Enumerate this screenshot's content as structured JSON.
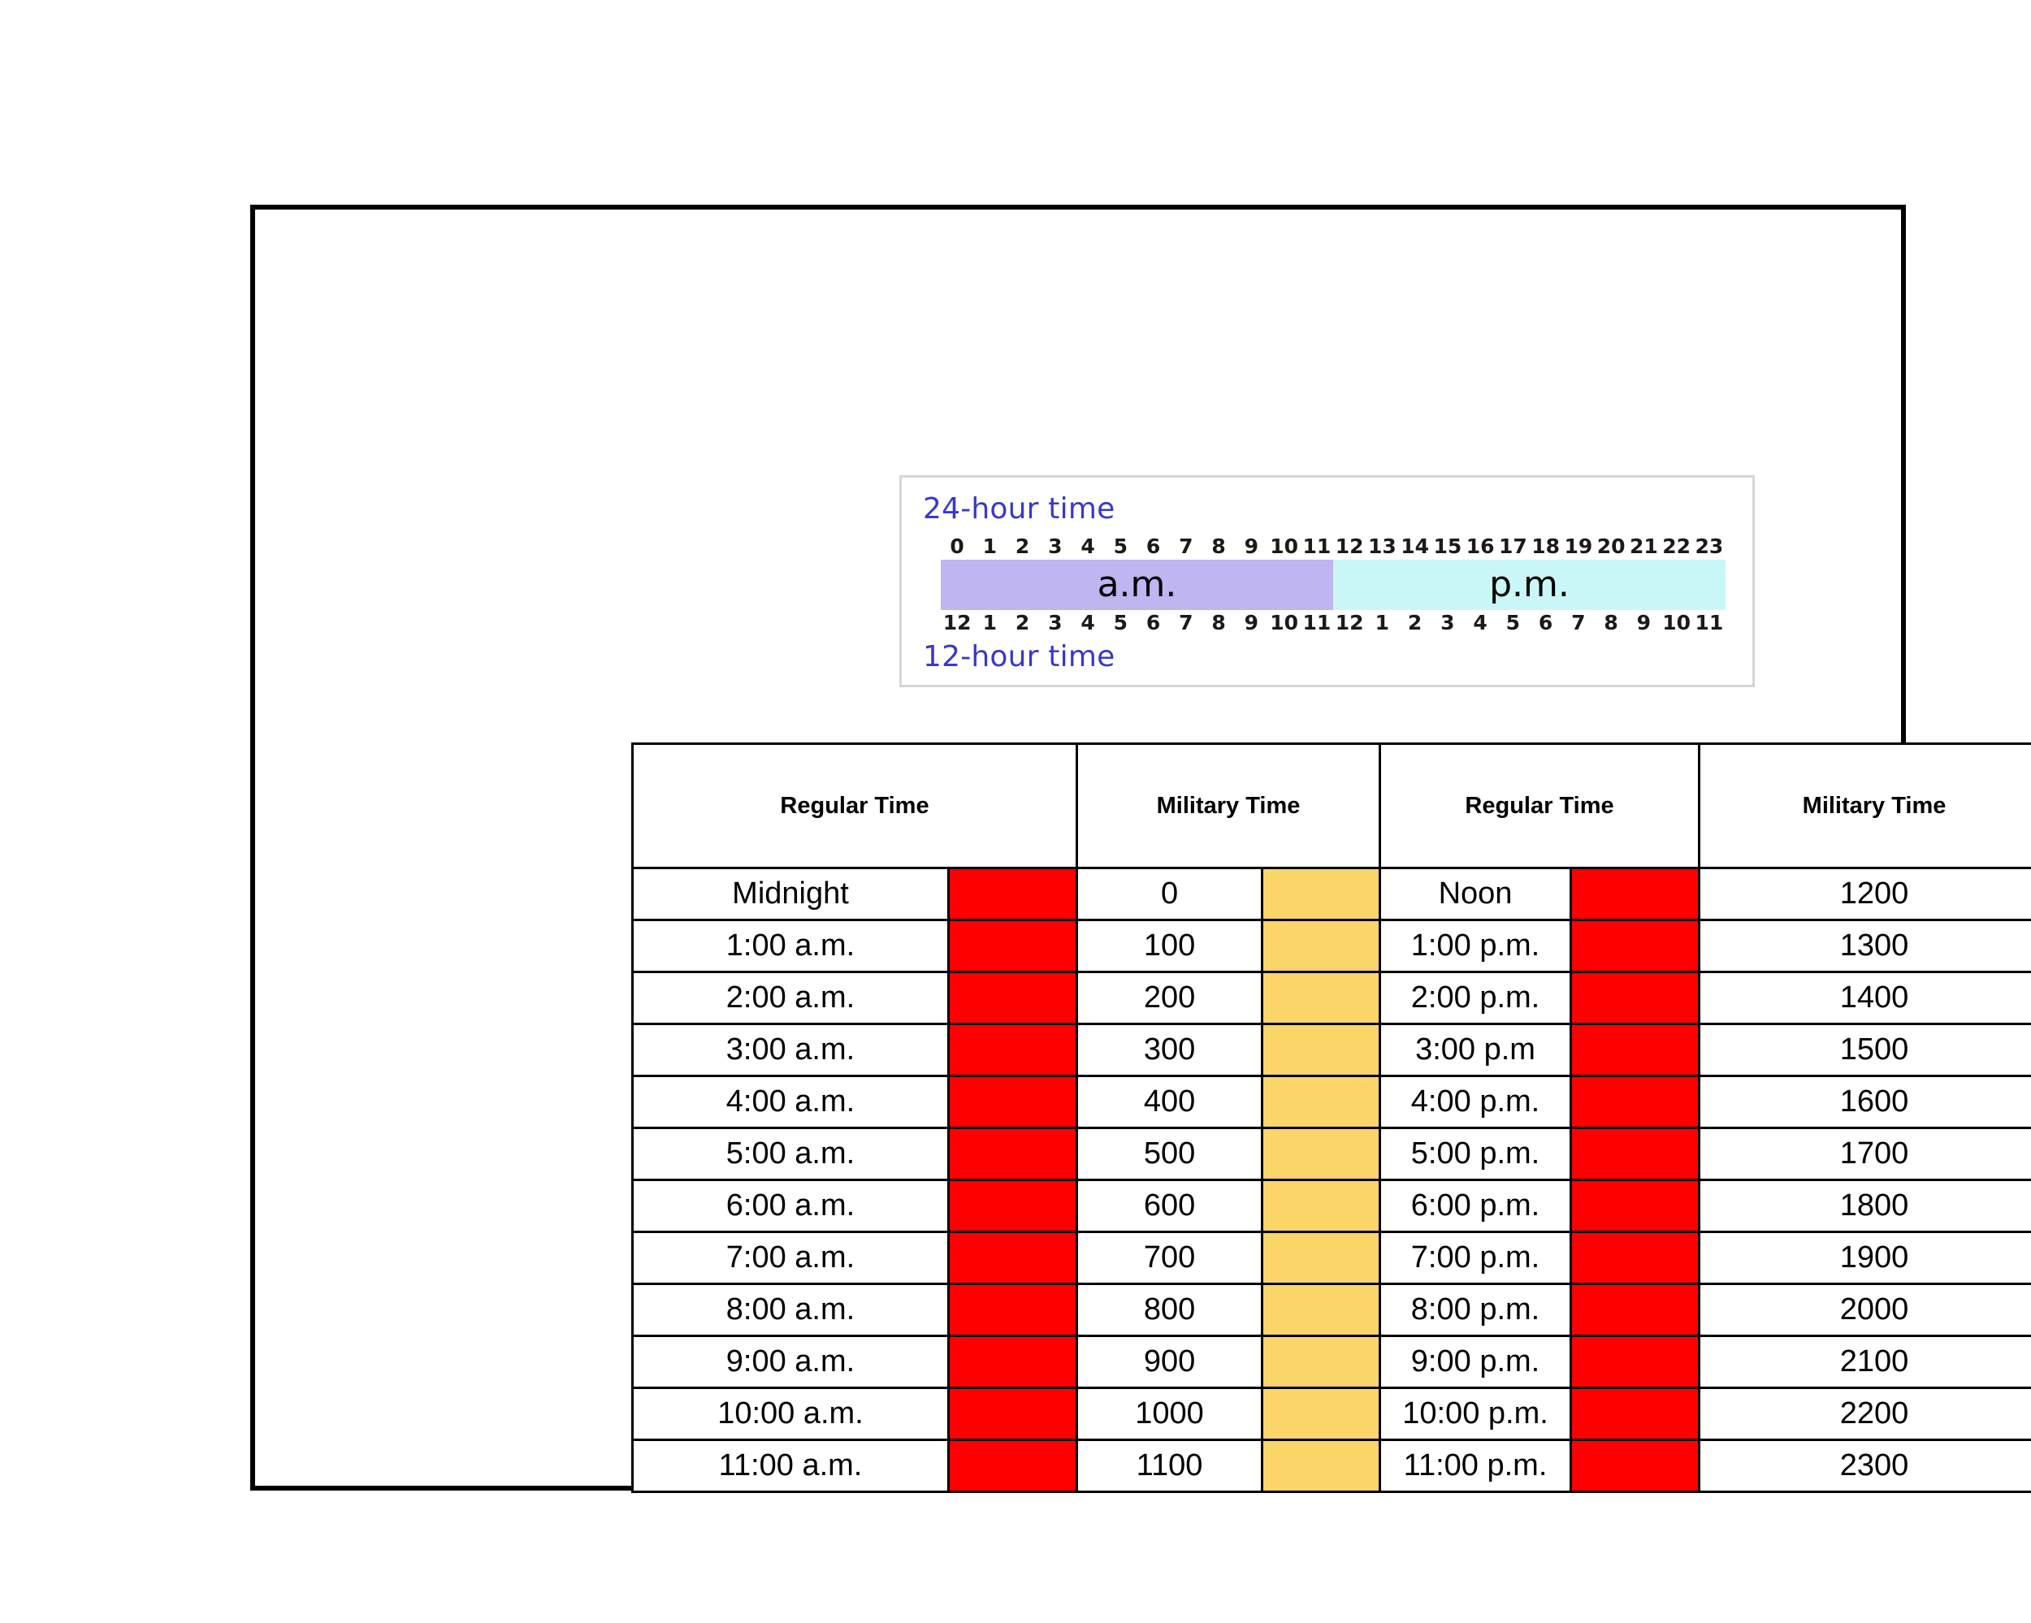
{
  "diagram": {
    "label_24": "24-hour time",
    "label_12": "12-hour time",
    "am_label": "a.m.",
    "pm_label": "p.m.",
    "ticks_24": [
      "0",
      "1",
      "2",
      "3",
      "4",
      "5",
      "6",
      "7",
      "8",
      "9",
      "10",
      "11",
      "12",
      "13",
      "14",
      "15",
      "16",
      "17",
      "18",
      "19",
      "20",
      "21",
      "22",
      "23"
    ],
    "ticks_12": [
      "12",
      "1",
      "2",
      "3",
      "4",
      "5",
      "6",
      "7",
      "8",
      "9",
      "10",
      "11",
      "12",
      "1",
      "2",
      "3",
      "4",
      "5",
      "6",
      "7",
      "8",
      "9",
      "10",
      "11"
    ],
    "colors": {
      "am_band": "#bfb5f0",
      "pm_band": "#c9f7f7",
      "label_text": "#3838cc",
      "box_border": "#d6d6d6"
    }
  },
  "table": {
    "headers": [
      "Regular Time",
      "Military Time",
      "Regular Time",
      "Military Time"
    ],
    "accent_colors": {
      "red": "#fe0000",
      "gold": "#fad568"
    },
    "rows": [
      {
        "regular_am": "Midnight",
        "military_am": "0",
        "regular_pm": "Noon",
        "military_pm": "1200"
      },
      {
        "regular_am": "1:00 a.m.",
        "military_am": "100",
        "regular_pm": "1:00 p.m.",
        "military_pm": "1300"
      },
      {
        "regular_am": "2:00 a.m.",
        "military_am": "200",
        "regular_pm": "2:00 p.m.",
        "military_pm": "1400"
      },
      {
        "regular_am": "3:00 a.m.",
        "military_am": "300",
        "regular_pm": "3:00 p.m",
        "military_pm": "1500"
      },
      {
        "regular_am": "4:00 a.m.",
        "military_am": "400",
        "regular_pm": "4:00 p.m.",
        "military_pm": "1600"
      },
      {
        "regular_am": "5:00 a.m.",
        "military_am": "500",
        "regular_pm": "5:00 p.m.",
        "military_pm": "1700"
      },
      {
        "regular_am": "6:00 a.m.",
        "military_am": "600",
        "regular_pm": "6:00 p.m.",
        "military_pm": "1800"
      },
      {
        "regular_am": "7:00 a.m.",
        "military_am": "700",
        "regular_pm": "7:00 p.m.",
        "military_pm": "1900"
      },
      {
        "regular_am": "8:00 a.m.",
        "military_am": "800",
        "regular_pm": "8:00 p.m.",
        "military_pm": "2000"
      },
      {
        "regular_am": "9:00 a.m.",
        "military_am": "900",
        "regular_pm": "9:00 p.m.",
        "military_pm": "2100"
      },
      {
        "regular_am": "10:00 a.m.",
        "military_am": "1000",
        "regular_pm": "10:00 p.m.",
        "military_pm": "2200"
      },
      {
        "regular_am": "11:00 a.m.",
        "military_am": "1100",
        "regular_pm": "11:00 p.m.",
        "military_pm": "2300"
      }
    ]
  }
}
